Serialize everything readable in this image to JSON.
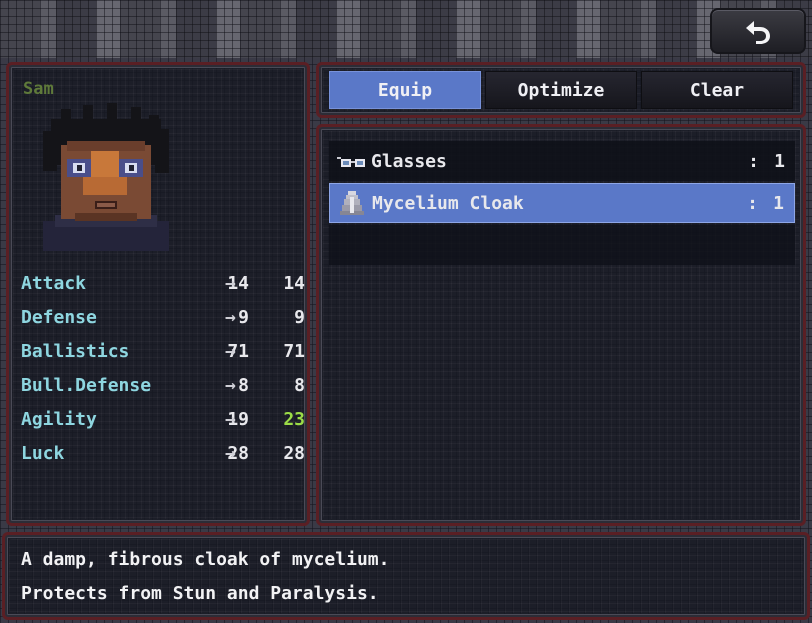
{
  "character": {
    "name": "Sam",
    "stats": [
      {
        "label": "Attack",
        "before": "14",
        "arrow": "→",
        "after": "14",
        "changed": false
      },
      {
        "label": "Defense",
        "before": "9",
        "arrow": "→",
        "after": "9",
        "changed": false
      },
      {
        "label": "Ballistics",
        "before": "71",
        "arrow": "→",
        "after": "71",
        "changed": false
      },
      {
        "label": "Bull.Defense",
        "before": "8",
        "arrow": "→",
        "after": "8",
        "changed": false
      },
      {
        "label": "Agility",
        "before": "19",
        "arrow": "→",
        "after": "23",
        "changed": true
      },
      {
        "label": "Luck",
        "before": "28",
        "arrow": "→",
        "after": "28",
        "changed": false
      }
    ]
  },
  "tabs": [
    {
      "label": "Equip",
      "active": true
    },
    {
      "label": "Optimize",
      "active": false
    },
    {
      "label": "Clear",
      "active": false
    }
  ],
  "items": [
    {
      "icon": "glasses-icon",
      "name": "Glasses",
      "separator": ":",
      "qty": "1",
      "selected": false
    },
    {
      "icon": "cloak-icon",
      "name": "Mycelium Cloak",
      "separator": ":",
      "qty": "1",
      "selected": true
    }
  ],
  "description": {
    "line1": "A damp, fibrous cloak of mycelium.",
    "line2": "Protects from Stun and Paralysis."
  },
  "back_button": {
    "icon": "undo-arrow-icon"
  },
  "colors": {
    "stat_label": "#8ed6e0",
    "stat_increase": "#9bdc47",
    "selection": "#5a78c8",
    "name_color": "#5f7a3a",
    "panel_border": "#5a1f24"
  }
}
